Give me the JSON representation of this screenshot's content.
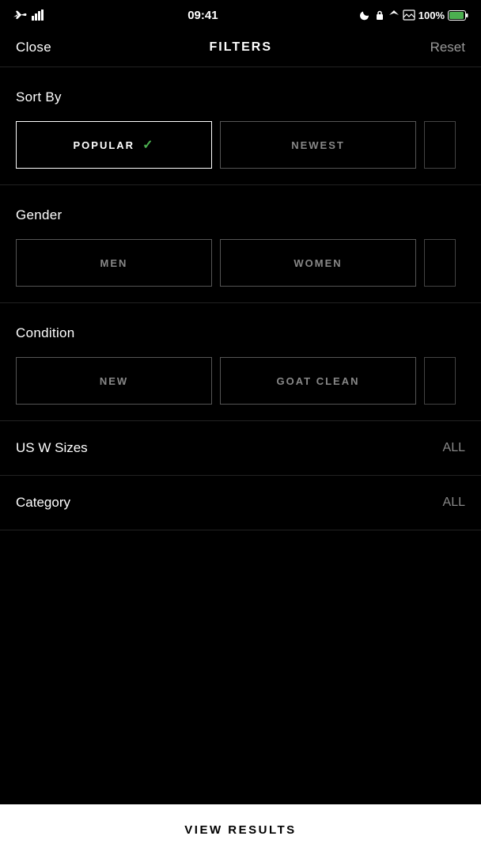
{
  "statusBar": {
    "time": "09:41",
    "battery": "100%",
    "signal": "Full"
  },
  "header": {
    "close_label": "Close",
    "title": "FILTERS",
    "reset_label": "Reset"
  },
  "sortBy": {
    "section_label": "Sort By",
    "options": [
      {
        "label": "POPULAR",
        "active": true
      },
      {
        "label": "NEWEST",
        "active": false
      }
    ]
  },
  "gender": {
    "section_label": "Gender",
    "options": [
      {
        "label": "MEN",
        "active": false
      },
      {
        "label": "WOMEN",
        "active": false
      }
    ]
  },
  "condition": {
    "section_label": "Condition",
    "options": [
      {
        "label": "NEW",
        "active": false
      },
      {
        "label": "GOAT CLEAN",
        "active": false
      }
    ]
  },
  "usSizes": {
    "section_label": "US W Sizes",
    "value": "ALL"
  },
  "category": {
    "section_label": "Category",
    "value": "ALL"
  },
  "viewResults": {
    "label": "VIEW RESULTS"
  }
}
